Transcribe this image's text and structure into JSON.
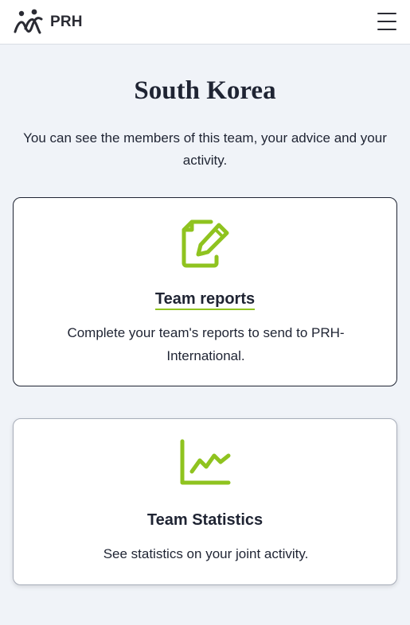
{
  "header": {
    "logo_text": "PRH",
    "menu_icon": "hamburger-menu-icon"
  },
  "page": {
    "title": "South Korea",
    "intro": "You can see the members of this team, your advice and your activity."
  },
  "cards": [
    {
      "icon": "document-edit-icon",
      "title": "Team reports",
      "description": "Complete your team's reports to send to PRH-International."
    },
    {
      "icon": "line-chart-icon",
      "title": "Team Statistics",
      "description": "See statistics on your joint activity."
    }
  ],
  "colors": {
    "accent": "#8fc31f",
    "text": "#1f2433",
    "background": "#f0f3f8"
  }
}
